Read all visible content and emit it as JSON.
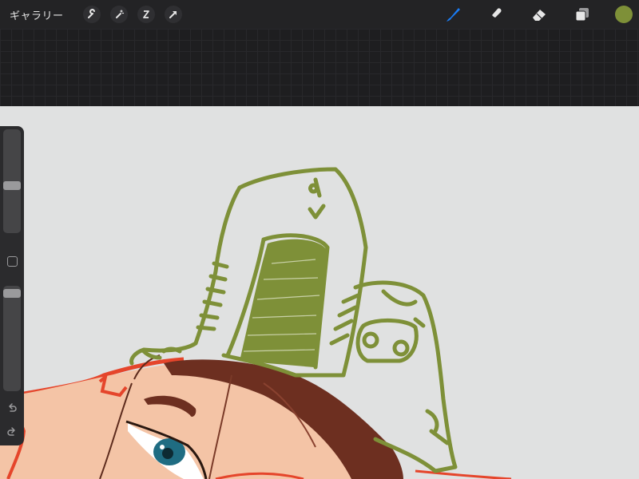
{
  "toolbar": {
    "gallery_label": "ギャラリー",
    "left_tools": [
      "wrench-icon",
      "magic-wand-icon",
      "selection-s-icon",
      "transform-arrow-icon"
    ],
    "right_tools": [
      "brush-icon",
      "smudge-icon",
      "eraser-icon",
      "layers-icon"
    ],
    "active_tool": "brush",
    "active_color": "#7e9038",
    "accent_color": "#1a7cf5"
  },
  "sidebar": {
    "brush_size_level": 0.45,
    "opacity_level": 0.97,
    "undo_icon": "undo-icon",
    "redo_icon": "redo-icon"
  },
  "colors": {
    "canvas_bg": "#e0e1e1",
    "sketch_green": "#7e9038",
    "skin": "#f4c4a6",
    "hair": "#6d2f20",
    "outline_red": "#e5452b"
  }
}
